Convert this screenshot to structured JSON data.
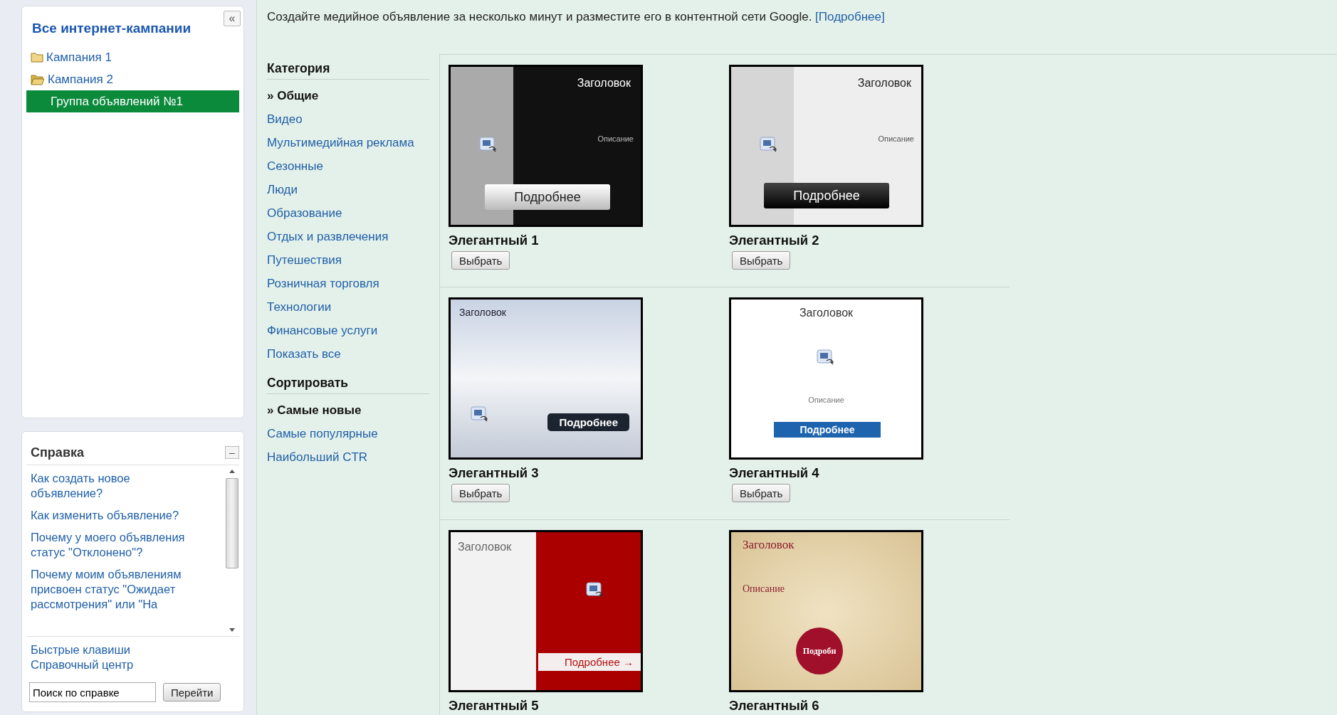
{
  "sidebar": {
    "title": "Все интернет-кампании",
    "collapse_button": "«",
    "tree": [
      {
        "label": "Кампания 1",
        "expanded": false,
        "selected": false
      },
      {
        "label": "Кампания 2",
        "expanded": true,
        "selected": false,
        "children": [
          {
            "label": "Группа объявлений №1",
            "selected": true
          }
        ]
      }
    ]
  },
  "help": {
    "title": "Справка",
    "collapse_button": "–",
    "questions": [
      "Как создать новое объявление?",
      "Как изменить объявление?",
      "Почему у моего объявления статус \"Отклонено\"?",
      "Почему моим объявлениям присвоен статус \"Ожидает рассмотрения\" или \"На"
    ],
    "links": [
      "Быстрые клавиши",
      "Справочный центр"
    ],
    "search": {
      "value": "Поиск по справке",
      "button": "Перейти"
    }
  },
  "intro": {
    "text": "Создайте медийное объявление за несколько минут и разместите его в контентной сети Google.",
    "link": "[Подробнее]"
  },
  "filters": [
    {
      "heading": "Категория",
      "items": [
        {
          "label": "» Общие",
          "selected": true
        },
        {
          "label": "Видео",
          "selected": false
        },
        {
          "label": "Мультимедийная реклама",
          "selected": false
        },
        {
          "label": "Сезонные",
          "selected": false
        },
        {
          "label": "Люди",
          "selected": false
        },
        {
          "label": "Образование",
          "selected": false
        },
        {
          "label": "Отдых и развлечения",
          "selected": false
        },
        {
          "label": "Путешествия",
          "selected": false
        },
        {
          "label": "Розничная торговля",
          "selected": false
        },
        {
          "label": "Технологии",
          "selected": false
        },
        {
          "label": "Финансовые услуги",
          "selected": false
        },
        {
          "label": "Показать все",
          "selected": false
        }
      ]
    },
    {
      "heading": "Сортировать",
      "items": [
        {
          "label": "» Самые новые",
          "selected": true
        },
        {
          "label": "Самые популярные",
          "selected": false
        },
        {
          "label": "Наибольший CTR",
          "selected": false
        }
      ]
    }
  ],
  "templates": [
    {
      "name": "Элегантный 1",
      "kind": "dark-split",
      "heading": "Заголовок",
      "description": "Описание",
      "cta": "Подробнее",
      "button": "Выбрать"
    },
    {
      "name": "Элегантный 2",
      "kind": "light-split",
      "heading": "Заголовок",
      "description": "Описание",
      "cta": "Подробнее",
      "button": "Выбрать"
    },
    {
      "name": "Элегантный 3",
      "kind": "wave",
      "heading": "Заголовок",
      "cta": "Подробнее",
      "button": "Выбрать"
    },
    {
      "name": "Элегантный 4",
      "kind": "white-box",
      "heading": "Заголовок",
      "description": "Описание",
      "cta": "Подробнее",
      "button": "Выбрать"
    },
    {
      "name": "Элегантный 5",
      "kind": "red-split",
      "heading": "Заголовок",
      "cta": "Подробнее →"
    },
    {
      "name": "Элегантный 6",
      "kind": "parchment",
      "heading": "Заголовок",
      "description": "Описание",
      "cta": "Подробн"
    }
  ]
}
